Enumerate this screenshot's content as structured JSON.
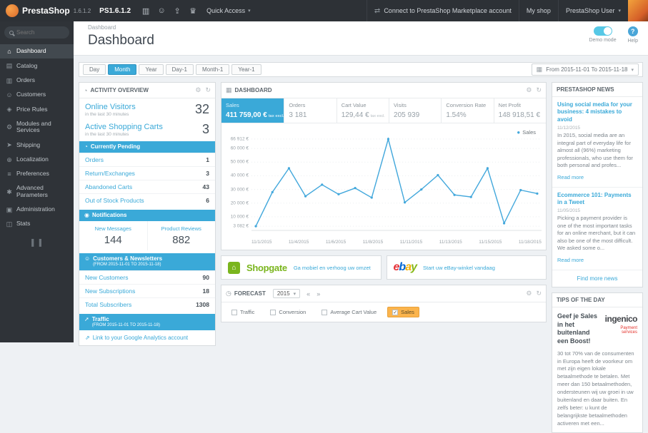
{
  "colors": {
    "accent": "#3aa9d8",
    "forecast_highlight": "#fbb44c",
    "chart_line": "#43a8dc"
  },
  "icons": {
    "caret": "▾",
    "cart": "▥",
    "customer": "☺",
    "upload": "⇪",
    "trophy": "♛",
    "connect": "⇄",
    "home": "⌂",
    "catalog": "▤",
    "orders": "▥",
    "customers": "☺",
    "price_rules": "◈",
    "modules": "⚙",
    "shipping": "➤",
    "localization": "⊕",
    "preferences": "≡",
    "advanced_parameters": "✱",
    "administration": "▣",
    "stats": "◫",
    "collapse": "▌▐",
    "gear": "⚙",
    "refresh": "↻",
    "activity": "◔",
    "dashboard": "▦",
    "calendar": "▦",
    "clock": "◔",
    "bell": "◉",
    "group": "☺",
    "traffic_arrow": "➚",
    "external_link": "⇗",
    "forecast": "◷",
    "nav_prev": "«",
    "nav_next": "»",
    "legend_dot": "●",
    "help": "?",
    "shopgate_bag": "⌂"
  },
  "topbar": {
    "brand": "PrestaShop",
    "version": "1.6.1.2",
    "shop_name": "PS1.6.1.2",
    "quick_access": "Quick Access",
    "marketplace_link": "Connect to PrestaShop Marketplace account",
    "my_shop": "My shop",
    "user_menu": "PrestaShop User"
  },
  "sidebar": {
    "search_placeholder": "Search",
    "items": [
      {
        "label": "Dashboard"
      },
      {
        "label": "Catalog"
      },
      {
        "label": "Orders"
      },
      {
        "label": "Customers"
      },
      {
        "label": "Price Rules"
      },
      {
        "label": "Modules and Services"
      },
      {
        "label": "Shipping"
      },
      {
        "label": "Localization"
      },
      {
        "label": "Preferences"
      },
      {
        "label": "Advanced Parameters"
      },
      {
        "label": "Administration"
      },
      {
        "label": "Stats"
      }
    ]
  },
  "page": {
    "breadcrumb": "Dashboard",
    "title": "Dashboard",
    "demo_mode_label": "Demo mode",
    "help_label": "Help"
  },
  "filters": {
    "buttons": [
      "Day",
      "Month",
      "Year",
      "Day-1",
      "Month-1",
      "Year-1"
    ],
    "active": "Month",
    "date_range": "From 2015-11-01 To 2015-11-18"
  },
  "activity": {
    "title": "ACTIVITY OVERVIEW",
    "online_visitors_label": "Online Visitors",
    "online_visitors_value": "32",
    "online_visitors_sub": "in the last 30 minutes",
    "carts_label": "Active Shopping Carts",
    "carts_value": "3",
    "carts_sub": "in the last 30 minutes",
    "pending_title": "Currently Pending",
    "pending_rows": [
      {
        "label": "Orders",
        "value": "1"
      },
      {
        "label": "Return/Exchanges",
        "value": "3"
      },
      {
        "label": "Abandoned Carts",
        "value": "43"
      },
      {
        "label": "Out of Stock Products",
        "value": "6"
      }
    ],
    "notifications_title": "Notifications",
    "notifications": [
      {
        "label": "New Messages",
        "value": "144"
      },
      {
        "label": "Product Reviews",
        "value": "882"
      }
    ],
    "customers_title": "Customers & Newsletters",
    "customers_sub": "(FROM 2015-11-01 TO 2015-11-18)",
    "customers_rows": [
      {
        "label": "New Customers",
        "value": "90"
      },
      {
        "label": "New Subscriptions",
        "value": "18"
      },
      {
        "label": "Total Subscribers",
        "value": "1308"
      }
    ],
    "traffic_title": "Traffic",
    "traffic_sub": "(FROM 2015-11-01 TO 2015-11-18)",
    "traffic_link": "Link to your Google Analytics account"
  },
  "dashboard": {
    "title": "DASHBOARD",
    "legend": "Sales",
    "metrics": [
      {
        "label": "Sales",
        "value": "411 759,00 €",
        "note": "tax excl."
      },
      {
        "label": "Orders",
        "value": "3 181"
      },
      {
        "label": "Cart Value",
        "value": "129,44 €",
        "note": "tax excl."
      },
      {
        "label": "Visits",
        "value": "205 939"
      },
      {
        "label": "Conversion Rate",
        "value": "1.54%"
      },
      {
        "label": "Net Profit",
        "value": "148 918,51 €"
      }
    ]
  },
  "chart_data": {
    "type": "line",
    "title": "Sales",
    "x": [
      "11/1/2015",
      "11/2/2015",
      "11/3/2015",
      "11/4/2015",
      "11/5/2015",
      "11/6/2015",
      "11/7/2015",
      "11/8/2015",
      "11/9/2015",
      "11/10/2015",
      "11/11/2015",
      "11/12/2015",
      "11/13/2015",
      "11/14/2015",
      "11/15/2015",
      "11/16/2015",
      "11/17/2015",
      "11/18/2015"
    ],
    "series": [
      {
        "name": "Sales",
        "values": [
          3082,
          28000,
          45500,
          25000,
          33500,
          26500,
          31000,
          24000,
          66912,
          20500,
          30000,
          40500,
          26000,
          24500,
          45500,
          5200,
          29500,
          27000
        ]
      }
    ],
    "ylim": [
      0,
      70000
    ],
    "yticks": [
      {
        "label": "66 912 €",
        "value": 66912
      },
      {
        "label": "60 000 €",
        "value": 60000
      },
      {
        "label": "50 000 €",
        "value": 50000
      },
      {
        "label": "40 000 €",
        "value": 40000
      },
      {
        "label": "30 000 €",
        "value": 30000
      },
      {
        "label": "20 000 €",
        "value": 20000
      },
      {
        "label": "10 000 €",
        "value": 10000
      },
      {
        "label": "3 082 €",
        "value": 3082
      }
    ],
    "xticks": [
      "11/1/2015",
      "11/4/2015",
      "11/6/2015",
      "11/8/2015",
      "11/11/2015",
      "11/13/2015",
      "11/15/2015",
      "11/18/2015"
    ],
    "legend_position": "top-right",
    "grid": true
  },
  "modules": {
    "shopgate_name": "Shopgate",
    "shopgate_link": "Ga mobiel en verhoog uw omzet",
    "ebay_letters": [
      "e",
      "b",
      "a",
      "y"
    ],
    "ebay_link": "Start uw eBay-winkel vandaag"
  },
  "forecast": {
    "title": "FORECAST",
    "year": "2015",
    "options": [
      {
        "label": "Traffic"
      },
      {
        "label": "Conversion"
      },
      {
        "label": "Average Cart Value"
      },
      {
        "label": "Sales",
        "active": true
      }
    ],
    "check_mark": "✓"
  },
  "news": {
    "title": "PRESTASHOP NEWS",
    "articles": [
      {
        "title": "Using social media for your business: 4 mistakes to avoid",
        "date": "11/12/2015",
        "excerpt": "In 2015, social media are an integral part of everyday life for almost all (96%) marketing professionals, who use them for both personal and profes...",
        "read_more": "Read more"
      },
      {
        "title": "Ecommerce 101: Payments in a Tweet",
        "date": "11/05/2015",
        "excerpt": "Picking a payment provider is one of the most important tasks for an online merchant, but it can also be one of the most difficult. We asked some o...",
        "read_more": "Read more"
      }
    ],
    "more_link": "Find more news"
  },
  "tips": {
    "title": "TIPS OF THE DAY",
    "headline": "Geef je Sales in het buitenland een Boost!",
    "logo_text": "ingenico",
    "logo_sub": "Payment services",
    "body": "30 tot 70% van de consumenten in Europa heeft de voorkeur om met zijn eigen lokale betaalmethode te betalen. Met meer dan 150 betaalmethoden, ondersteunen wij uw groei in uw buitenland en daar buiten. En zelfs beter: u kunt de belangrijkste betaalmethoden activeren met een..."
  }
}
